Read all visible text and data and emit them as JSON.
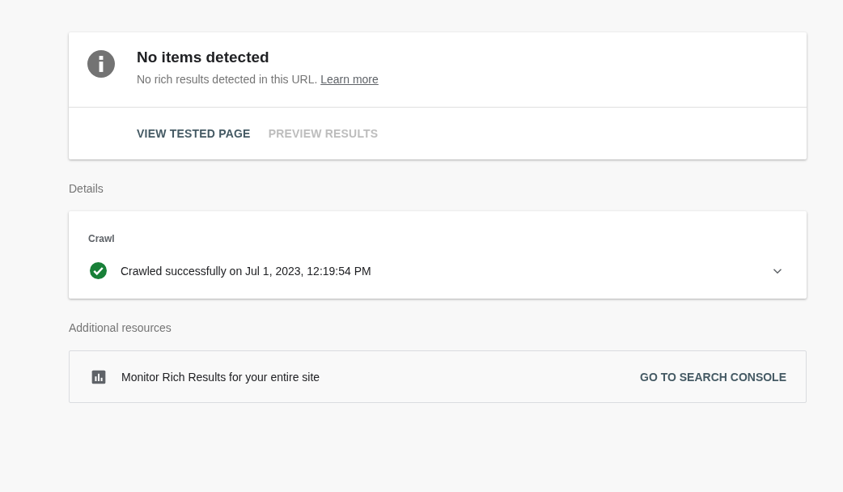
{
  "result_card": {
    "kind": "info",
    "title": "No items detected",
    "message": "No rich results detected in this URL.",
    "link": "Learn more",
    "actions": [
      {
        "label": "VIEW TESTED PAGE",
        "disabled": false
      },
      {
        "label": "PREVIEW RESULTS",
        "disabled": true
      }
    ]
  },
  "details": {
    "heading": "Details",
    "sections": [
      {
        "label": "Crawl",
        "kind": "success",
        "text": "Crawled successfully on Jul 1, 2023, 12:19:54 PM",
        "expanded": false
      }
    ]
  },
  "additional_resources": {
    "heading": "Additional resources",
    "items": [
      {
        "text": "Monitor Rich Results for your entire site",
        "action": "GO TO SEARCH CONSOLE"
      }
    ]
  }
}
